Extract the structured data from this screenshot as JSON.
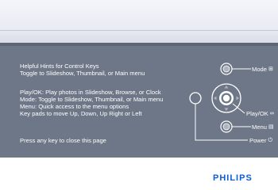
{
  "hints": {
    "title": "Helpful Hints for Control Keys",
    "subtitle": "Toggle to Slideshow, Thumbnail, or Main menu",
    "lines": [
      "Play/OK: Play photos in Slideshow, Browse, or Clock",
      "Mode: Toggle to Slideshow, Thumbnail, or Main menu",
      "Menu: Quick access to the menu options",
      "Key pads to move Up, Down, Up Right or Left"
    ],
    "close_note": "Press any key to close this page"
  },
  "keys": {
    "mode": "Mode",
    "play_ok": "Play/OK",
    "menu": "Menu",
    "power": "Power"
  },
  "icons": {
    "mode": "mode-icon",
    "play_ok": "play-ok-icon",
    "menu": "menu-icon",
    "power": "power-icon"
  },
  "brand": "PHILIPS",
  "colors": {
    "panel": "#6e7787",
    "brand": "#0b5ed7"
  }
}
